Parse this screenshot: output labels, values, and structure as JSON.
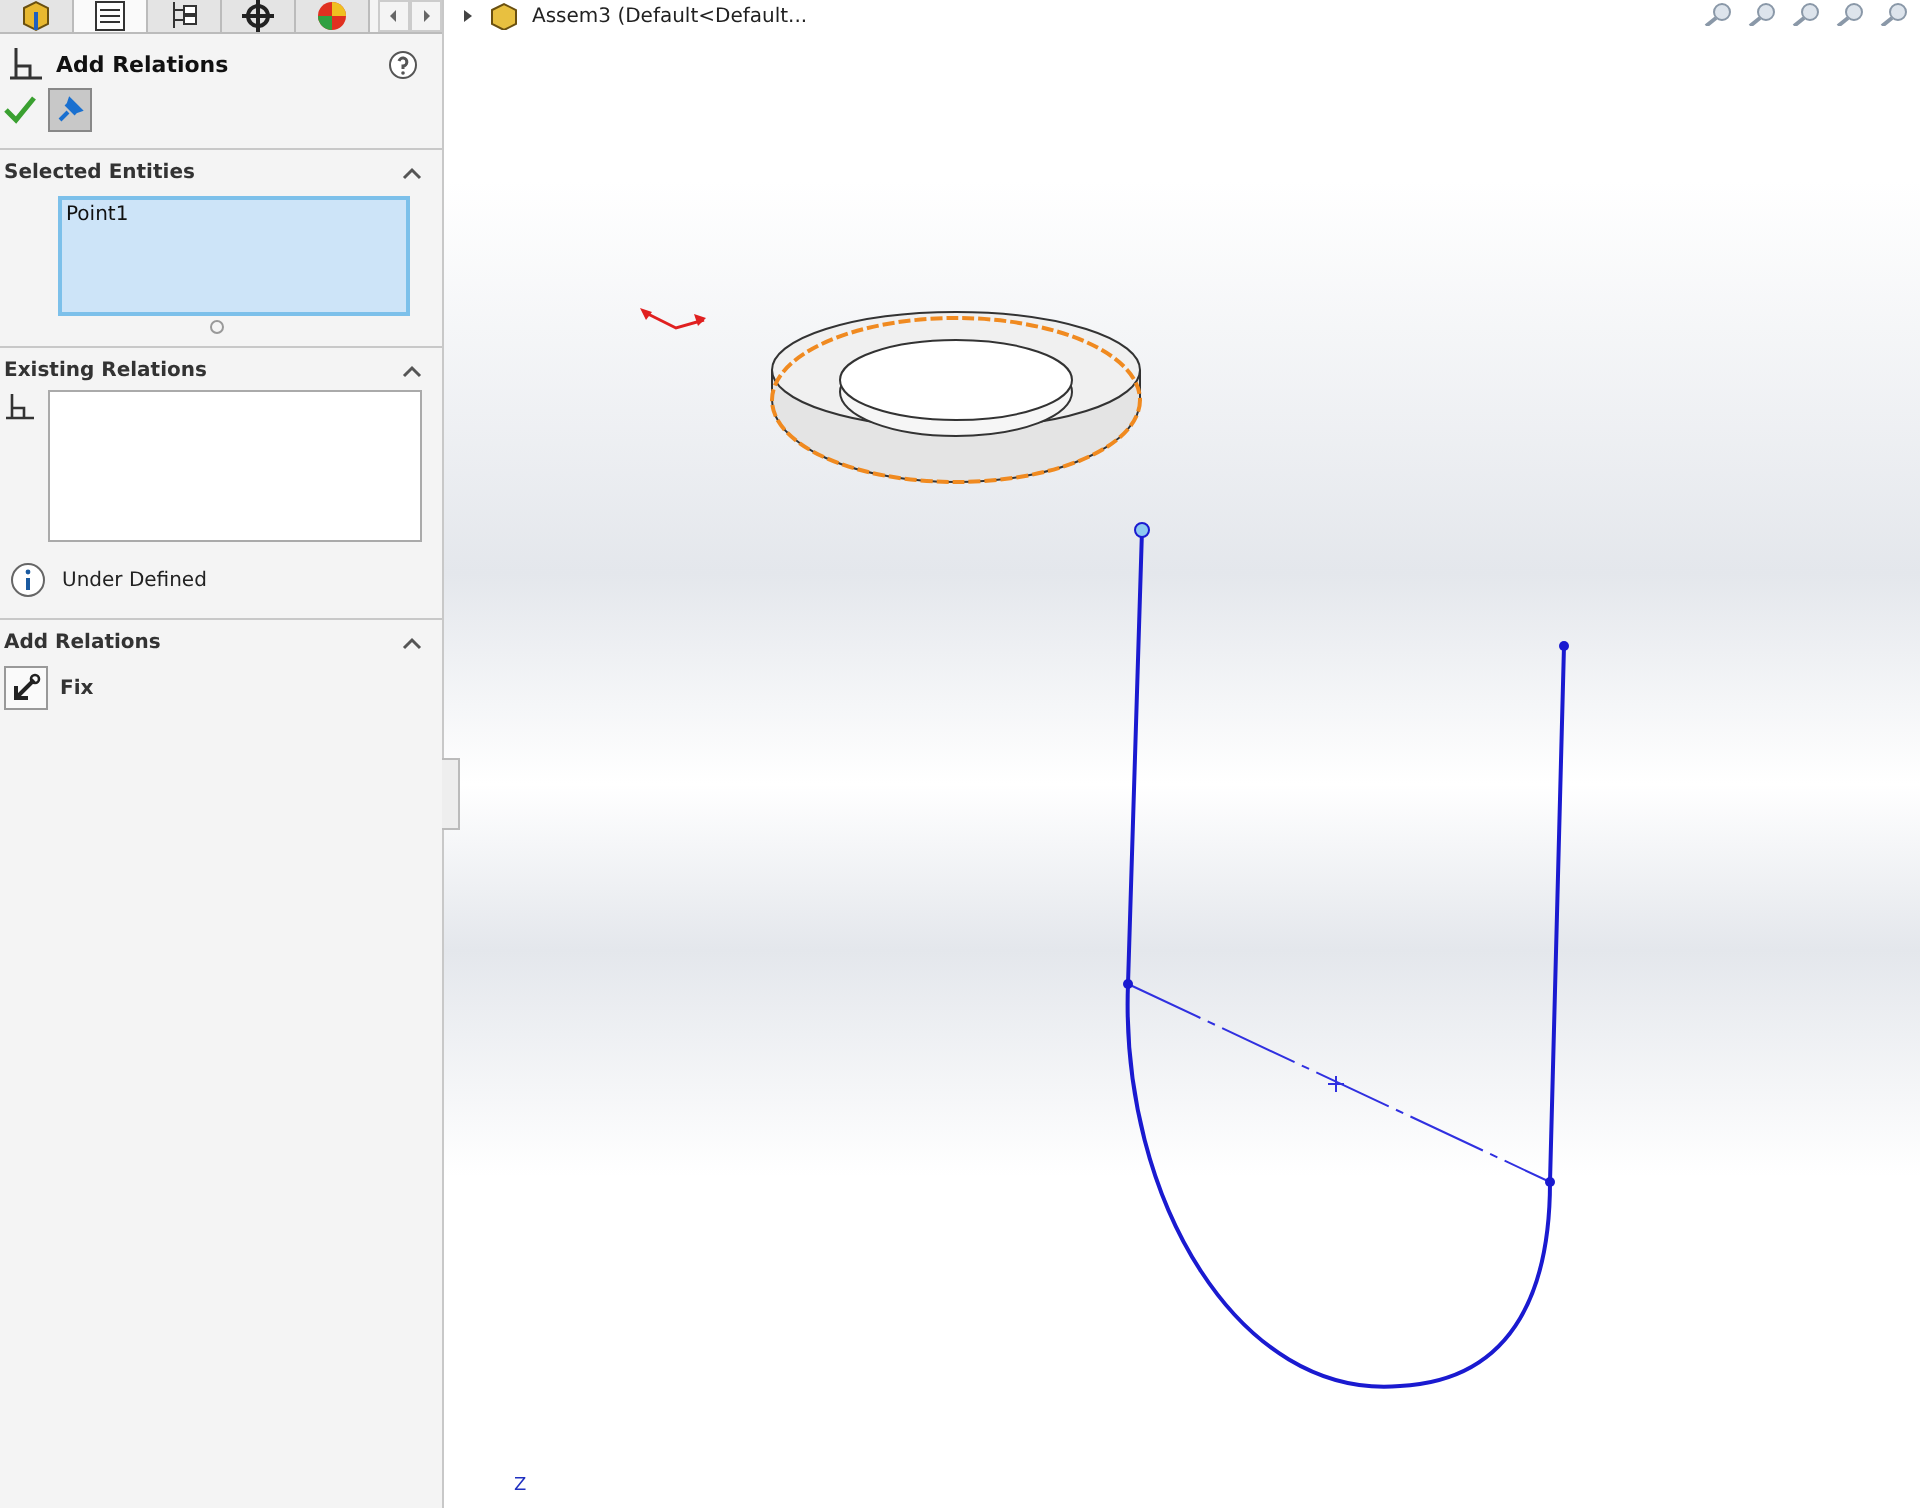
{
  "tabs": [
    {
      "kind": "part",
      "selected": false
    },
    {
      "kind": "list",
      "selected": true
    },
    {
      "kind": "tree",
      "selected": false
    },
    {
      "kind": "target",
      "selected": false
    },
    {
      "kind": "color",
      "selected": false
    }
  ],
  "property_manager": {
    "title": "Add Relations",
    "selected_entities": {
      "title": "Selected Entities",
      "expanded": true,
      "items": [
        "Point1"
      ]
    },
    "existing_relations": {
      "title": "Existing Relations",
      "expanded": true,
      "status": "Under Defined"
    },
    "add_relations": {
      "title": "Add Relations",
      "expanded": true,
      "items": [
        {
          "label": "Fix"
        }
      ]
    }
  },
  "tree_header": "Assem3  (Default<Default...",
  "axis_label": "Z"
}
